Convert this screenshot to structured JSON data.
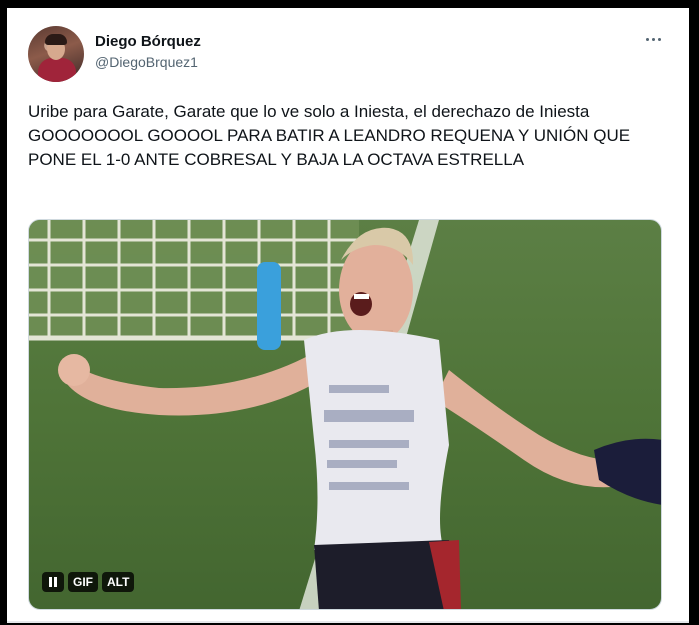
{
  "tweet": {
    "author_name": "Diego Bórquez",
    "author_handle": "@DiegoBrquez1",
    "text": "Uribe para Garate, Garate que lo ve solo a Iniesta, el derechazo de Iniesta GOOOOOOOL GOOOOL PARA BATIR A LEANDRO REQUENA Y UNIÓN QUE PONE EL 1-0 ANTE COBRESAL Y BAJA LA OCTAVA ESTRELLA",
    "more_icon": "more-horizontal-icon"
  },
  "media": {
    "type": "gif",
    "gif_label": "GIF",
    "alt_label": "ALT",
    "pause_icon": "pause-icon"
  },
  "colors": {
    "text_primary": "#0f1419",
    "text_secondary": "#536471",
    "pitch_green": "#4f7438"
  }
}
